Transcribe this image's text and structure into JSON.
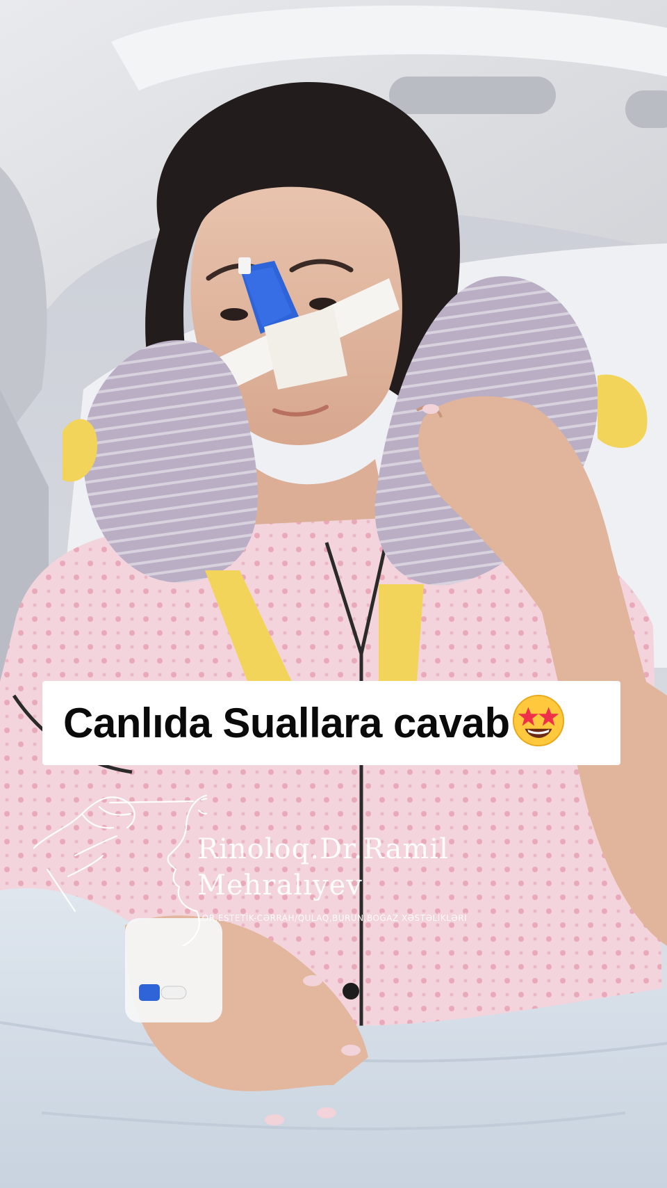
{
  "caption": {
    "text": "Canlıda Suallara cavab",
    "emoji": "star-struck-emoji-icon"
  },
  "watermark": {
    "name_line_1": "Rinoloq.Dr.Ramil",
    "name_line_2": "Mehralıyev",
    "subtitle": "LOR,ESTETİK-CƏRRAH/QULAQ,BURUN,BOĞAZ XƏSTƏLİKLƏRİ"
  },
  "colors": {
    "caption_background": "#ffffff",
    "caption_text": "#0a0a0a",
    "pajama_pink": "#f2c7d2",
    "pillow_lavender": "#b9aec4",
    "nasal_splint_blue": "#2f63d8",
    "pillow_accent_yellow": "#f3d45a"
  }
}
